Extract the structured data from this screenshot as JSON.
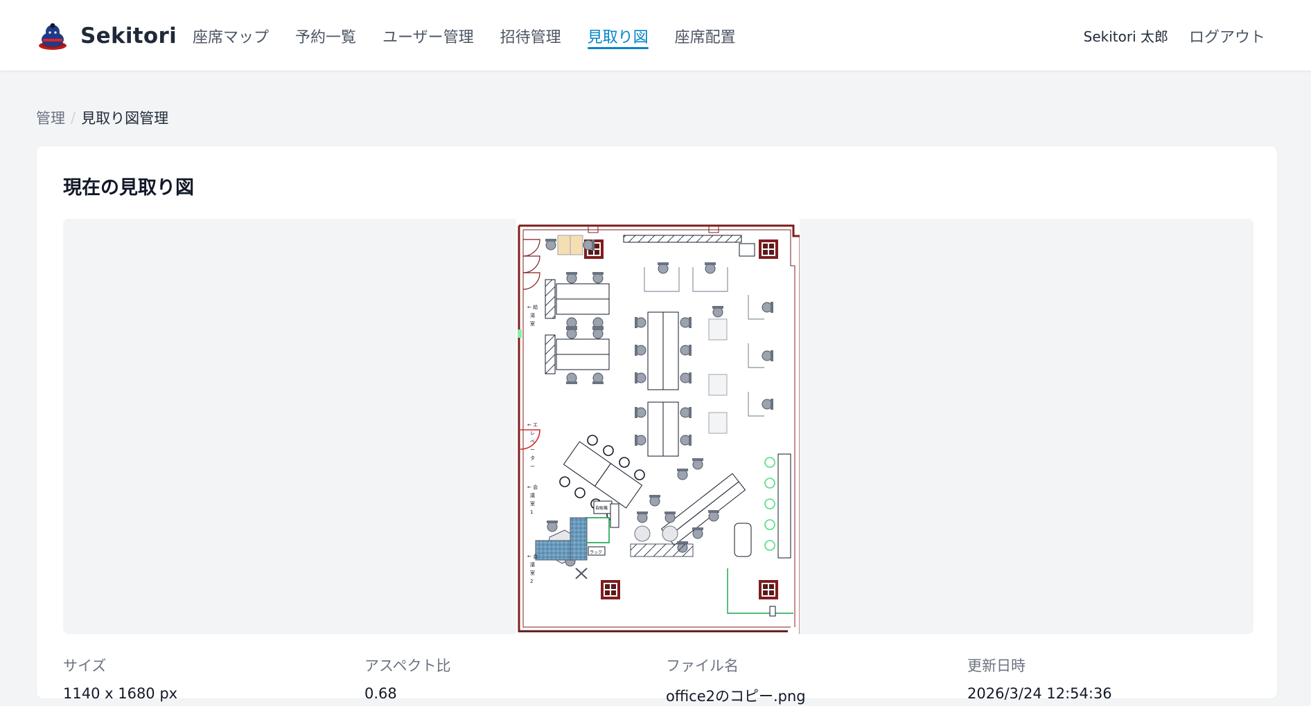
{
  "app": {
    "name": "Sekitori"
  },
  "nav": {
    "items": [
      {
        "label": "座席マップ"
      },
      {
        "label": "予約一覧"
      },
      {
        "label": "ユーザー管理"
      },
      {
        "label": "招待管理"
      },
      {
        "label": "見取り図",
        "active": true
      },
      {
        "label": "座席配置"
      }
    ]
  },
  "user": {
    "name": "Sekitori 太郎",
    "logout_label": "ログアウト"
  },
  "breadcrumb": {
    "parent": "管理",
    "separator": "/",
    "current": "見取り図管理"
  },
  "card": {
    "title": "現在の見取り図",
    "meta": [
      {
        "label": "サイズ",
        "value": "1140 x 1680 px"
      },
      {
        "label": "アスペクト比",
        "value": "0.68"
      },
      {
        "label": "ファイル名",
        "value": "office2のコピー.png"
      },
      {
        "label": "更新日時",
        "value": "2026/3/24 12:54:36"
      }
    ]
  },
  "floorplan_labels": {
    "kyutoshitsu": "給湯室",
    "elevator": "エレベーター",
    "kaigishitsu1": "会議室1",
    "kaigishitsu2": "会議室2",
    "vending": "自販機",
    "shelf": "ラック"
  },
  "colors": {
    "accent": "#0284c7",
    "wall": "#7f1d1d",
    "pillar": "#5b1a1a",
    "carpet": "#7aa7c7"
  }
}
